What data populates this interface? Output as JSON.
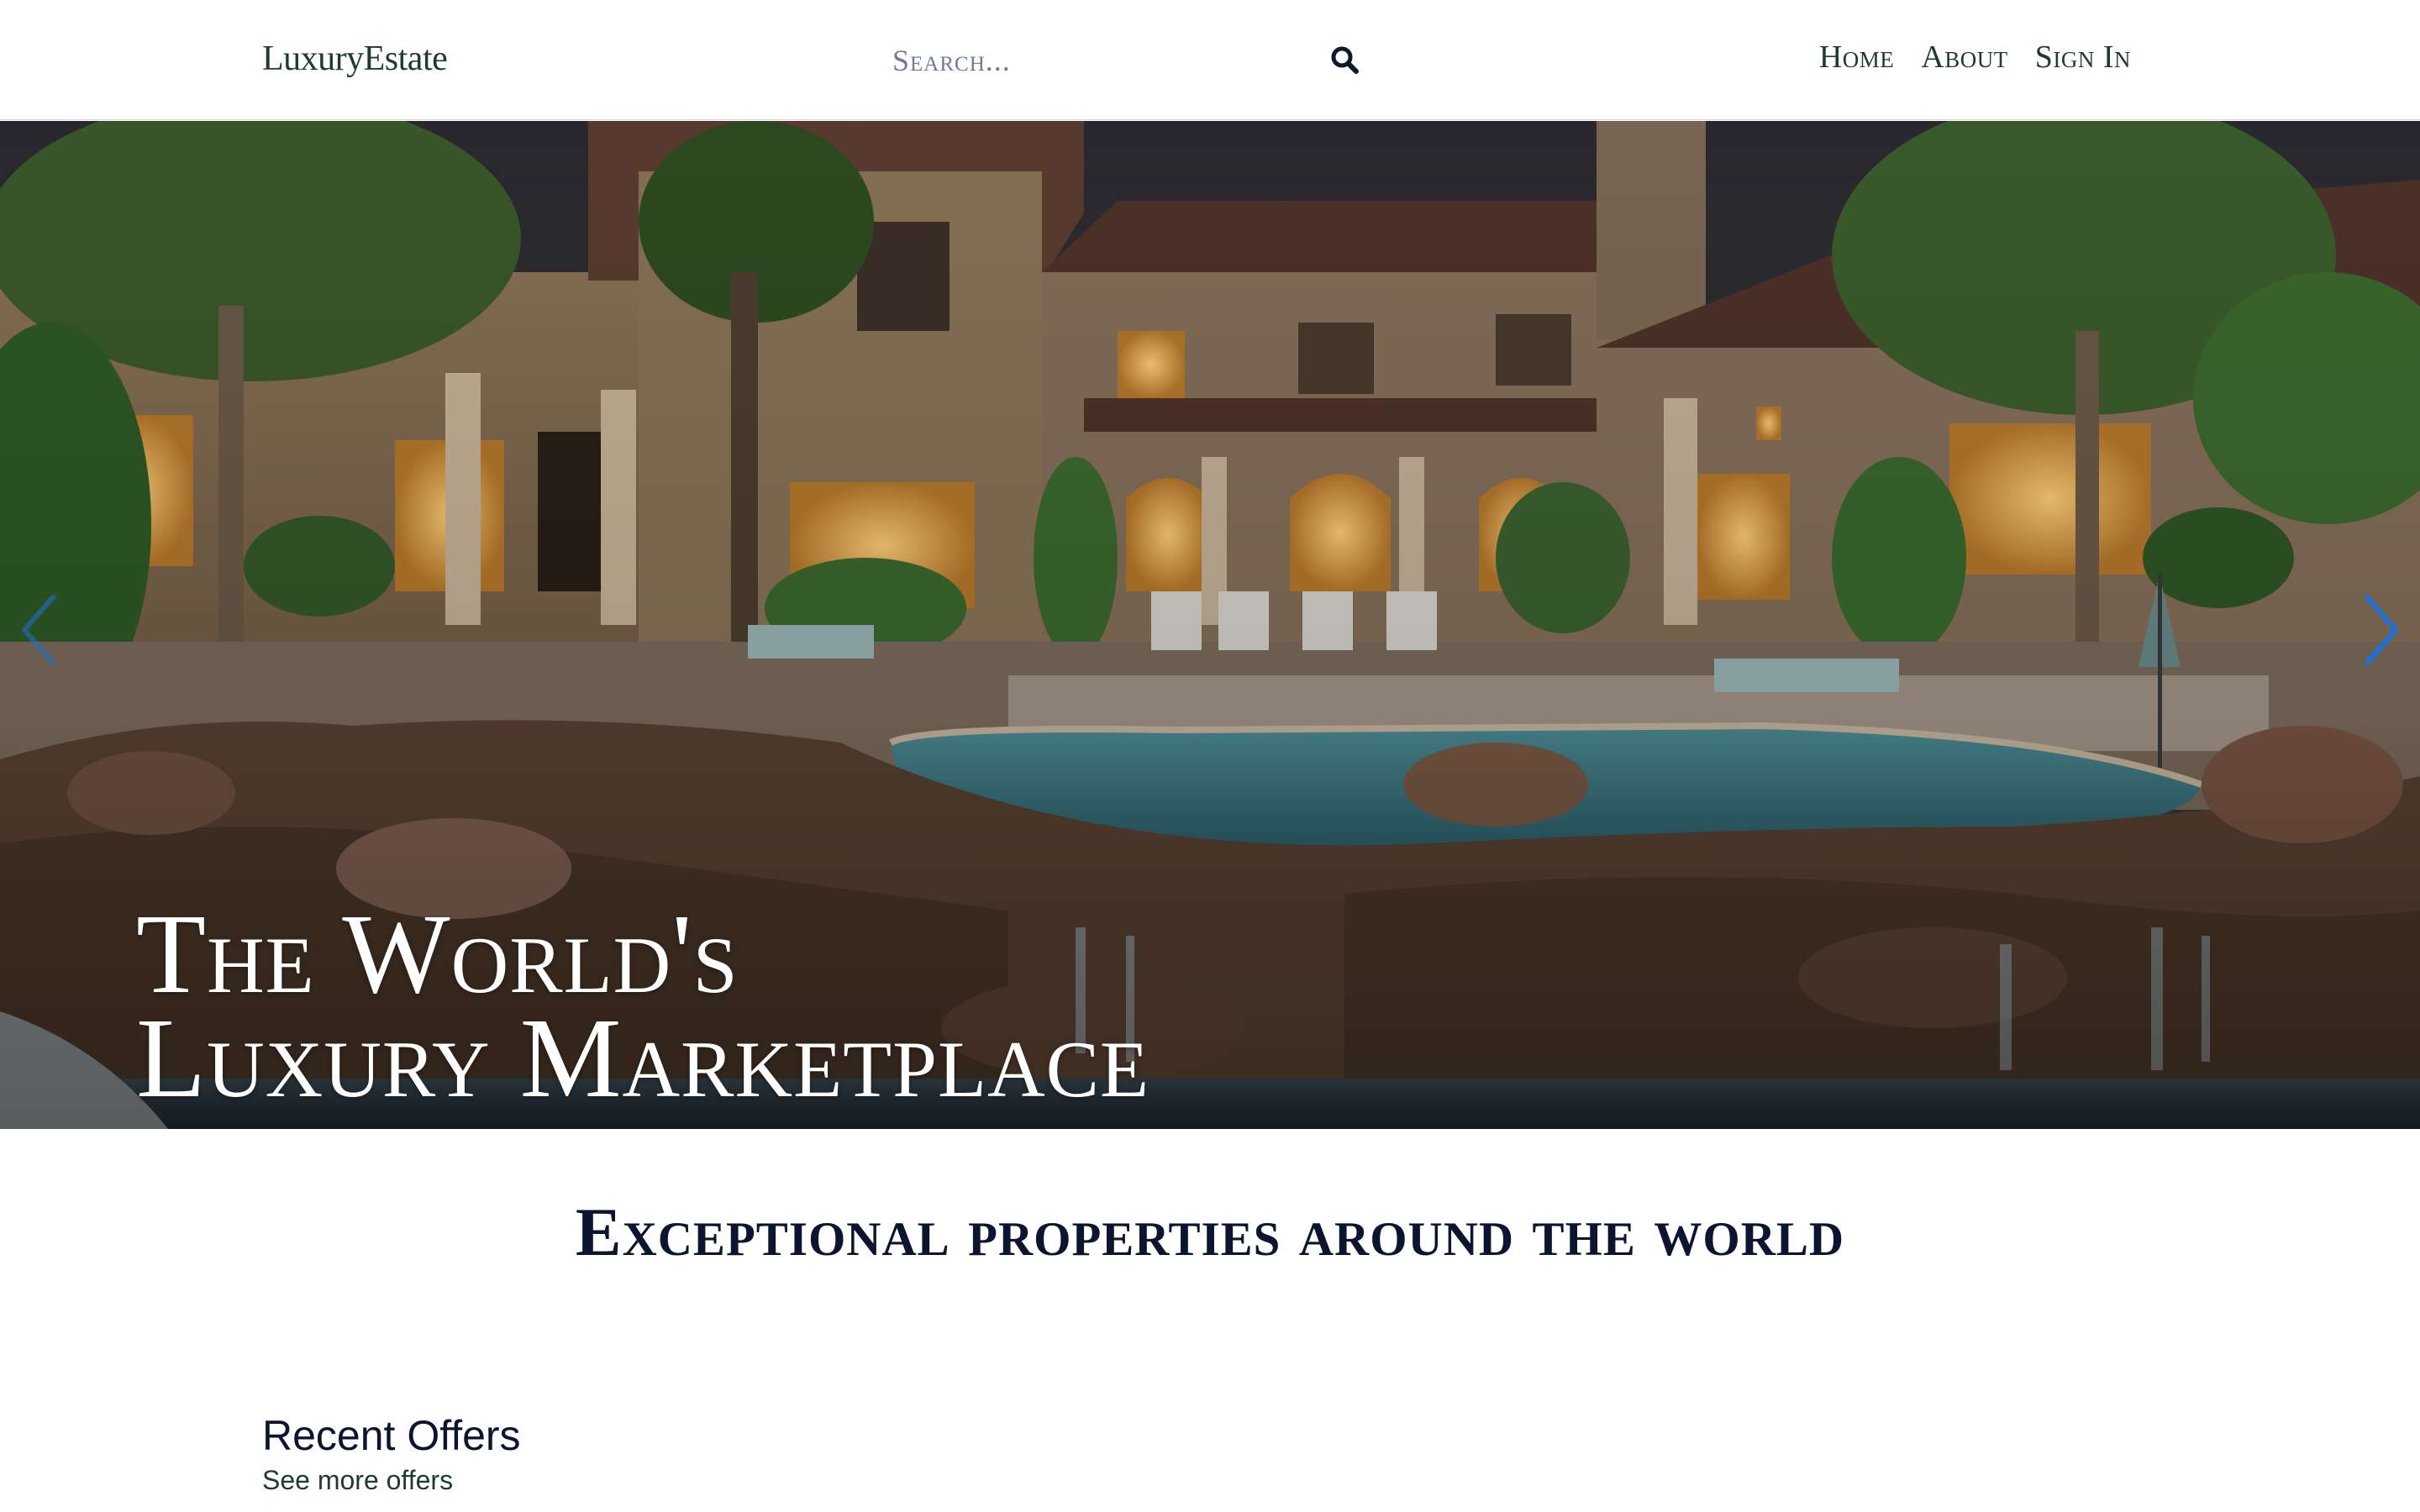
{
  "header": {
    "logo": "LuxuryEstate",
    "search": {
      "placeholder": "Search..."
    },
    "nav": {
      "home": "Home",
      "about": "About",
      "sign_in": "Sign In"
    }
  },
  "hero": {
    "title_line1": "The World's",
    "title_line2": "Luxury Marketplace",
    "image": "luxury-villa-pool-photo"
  },
  "tagline": "Exceptional properties around the world",
  "recent_offers": {
    "title": "Recent Offers",
    "link": "See more offers"
  },
  "colors": {
    "brand_green": "#1f3a2e",
    "navy_text": "#0b1530",
    "carousel_arrow": "#1f6fd6"
  },
  "icons": {
    "search": "search-icon",
    "prev": "chevron-left-icon",
    "next": "chevron-right-icon"
  }
}
